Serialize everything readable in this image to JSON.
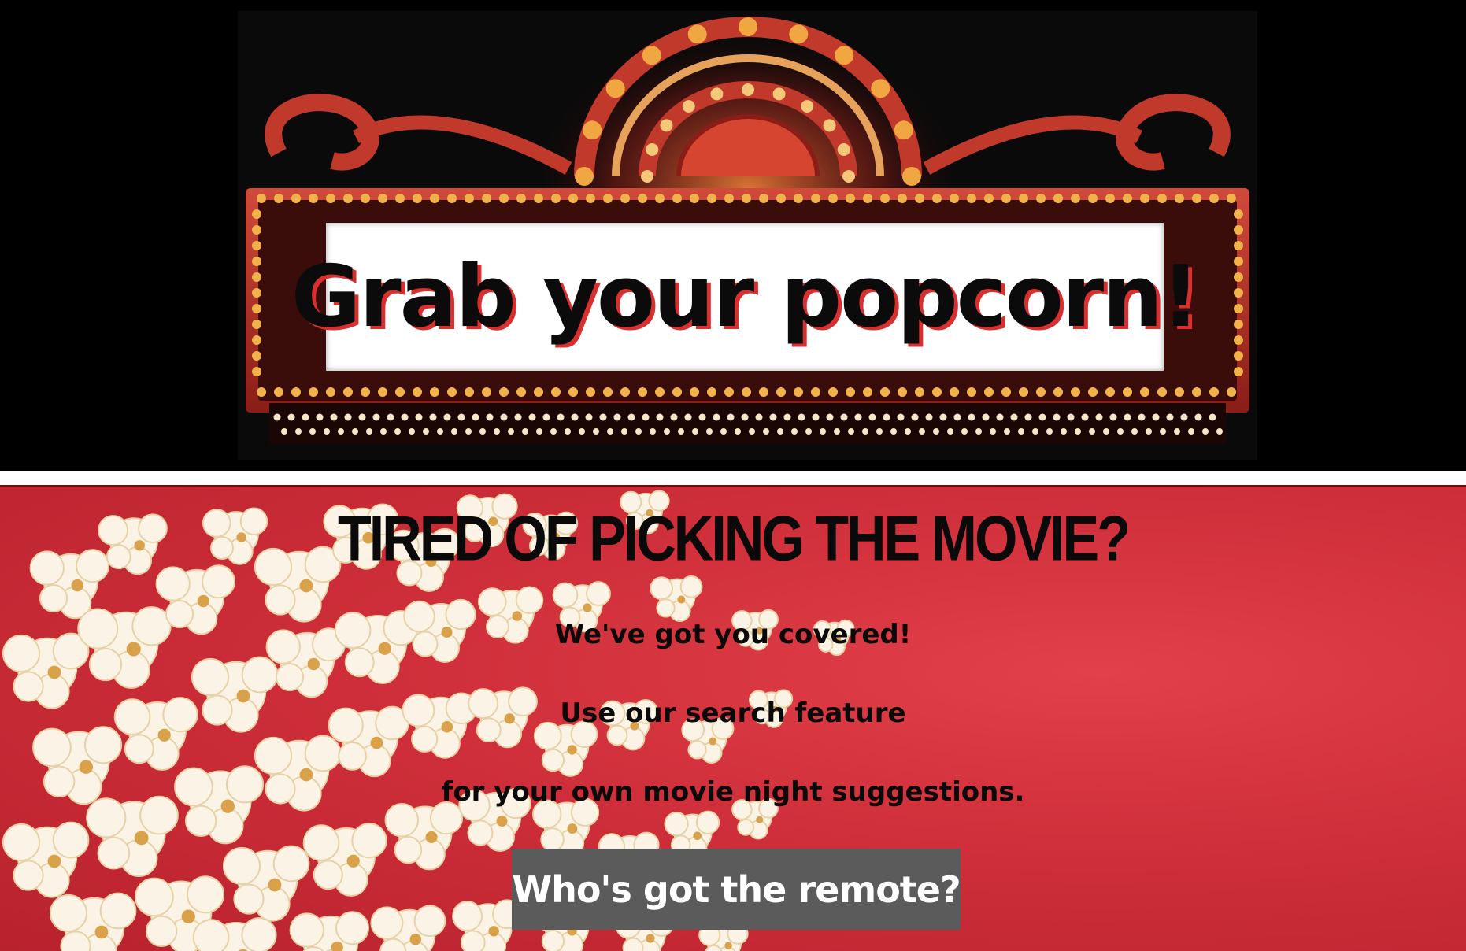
{
  "header": {
    "sign_text": "Grab your popcorn!"
  },
  "hero": {
    "title": "TIRED OF PICKING THE MOVIE?",
    "line1": "We've got you covered!",
    "line2": "Use our search feature",
    "line3": "for your own movie night suggestions.",
    "button_label": "Who's got the remote?"
  },
  "colors": {
    "hero_red": "#cf2f3a",
    "button_gray": "#5b5b5b",
    "marquee_red": "#c0392b",
    "bulb_gold": "#f2b24a"
  }
}
